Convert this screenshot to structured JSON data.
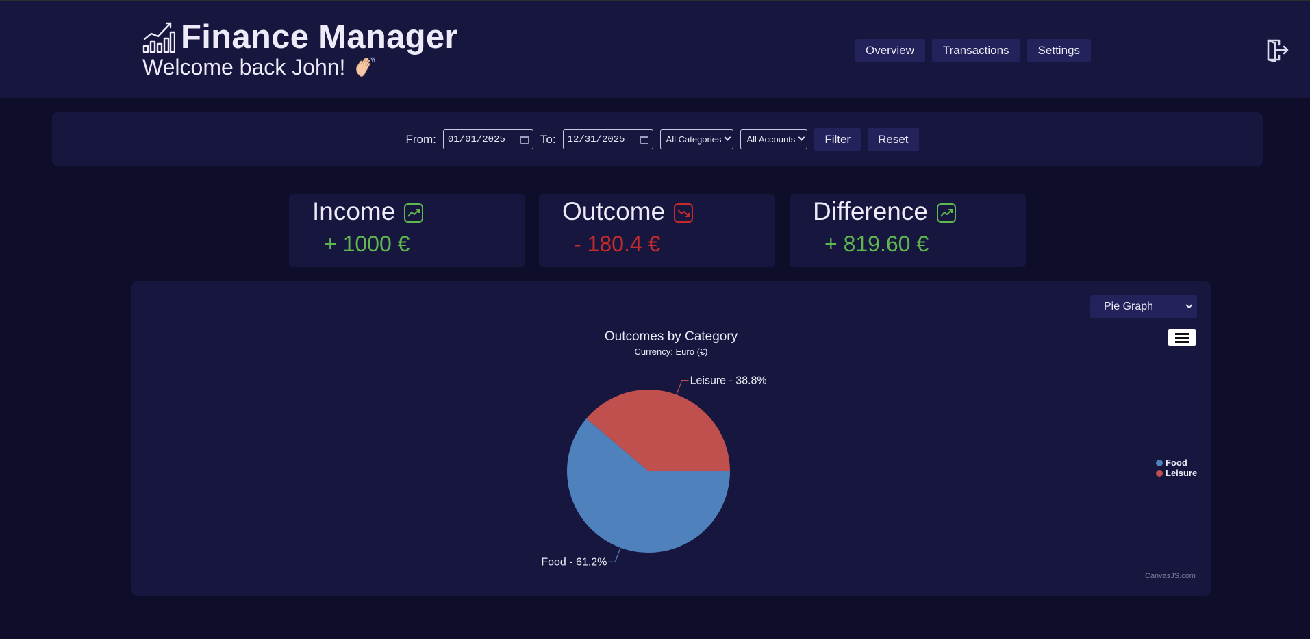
{
  "header": {
    "title": "Finance Manager",
    "welcome": "Welcome back John!",
    "nav": [
      "Overview",
      "Transactions",
      "Settings"
    ]
  },
  "filter": {
    "from_label": "From:",
    "from_value": "01/01/2025",
    "to_label": "To:",
    "to_value": "12/31/2025",
    "category": "All Categories",
    "account": "All Accounts",
    "filter_label": "Filter",
    "reset_label": "Reset"
  },
  "cards": [
    {
      "title": "Income",
      "value": "+ 1000 €",
      "trend": "trend-up-icon",
      "color": "#5fb84e"
    },
    {
      "title": "Outcome",
      "value": "- 180.4 €",
      "trend": "trend-down-icon",
      "color": "#c42b2b"
    },
    {
      "title": "Difference",
      "value": "+ 819.60 €",
      "trend": "trend-up-icon",
      "color": "#5fb84e"
    }
  ],
  "chart_controls": {
    "graph_type": "Pie Graph",
    "credit": "CanvasJS.com"
  },
  "chart_data": {
    "type": "pie",
    "title": "Outcomes by Category",
    "subtitle": "Currency: Euro (€)",
    "slices": [
      {
        "name": "Food",
        "percent": 61.2,
        "label": "Food - 61.2%",
        "color": "#4f81bc"
      },
      {
        "name": "Leisure",
        "percent": 38.8,
        "label": "Leisure - 38.8%",
        "color": "#c0504e"
      }
    ],
    "legend": [
      "Food",
      "Leisure"
    ],
    "legend_position": "right"
  }
}
